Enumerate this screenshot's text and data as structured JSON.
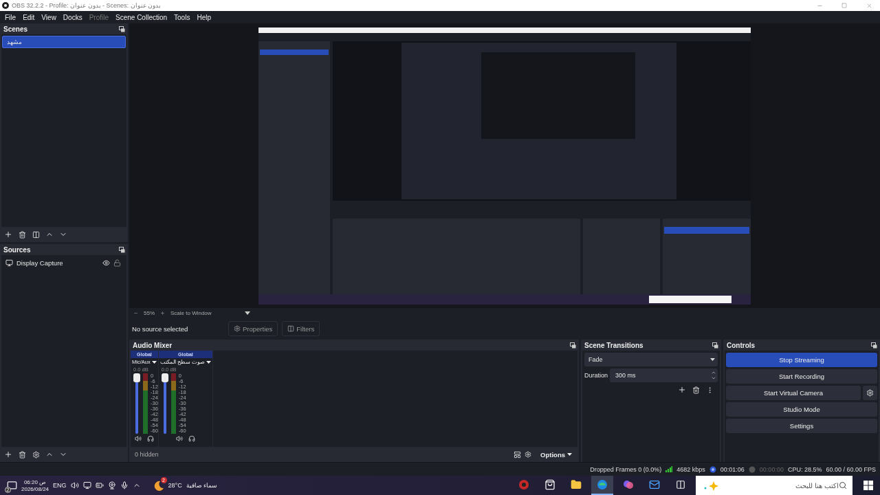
{
  "window": {
    "title": "OBS 32.2.2 - Profile: بدون عنوان - Scenes: بدون عنوان"
  },
  "menu": [
    {
      "label": "File",
      "disabled": false
    },
    {
      "label": "Edit",
      "disabled": false
    },
    {
      "label": "View",
      "disabled": false
    },
    {
      "label": "Docks",
      "disabled": false
    },
    {
      "label": "Profile",
      "disabled": true
    },
    {
      "label": "Scene Collection",
      "disabled": false
    },
    {
      "label": "Tools",
      "disabled": false
    },
    {
      "label": "Help",
      "disabled": false
    }
  ],
  "scenes": {
    "title": "Scenes",
    "items": [
      {
        "name": "مشهد",
        "selected": true
      }
    ]
  },
  "sources": {
    "title": "Sources",
    "items": [
      {
        "name": "Display Capture",
        "visible": true,
        "locked": false
      }
    ]
  },
  "zoom_bar": {
    "zoom": "55%",
    "scale_mode": "Scale to Window"
  },
  "source_bar": {
    "status": "No source selected",
    "buttons": [
      {
        "kind": "properties",
        "label": "Properties"
      },
      {
        "kind": "filters",
        "label": "Filters"
      }
    ]
  },
  "audio_mixer": {
    "title": "Audio Mixer",
    "channels": [
      {
        "tag": "Global",
        "name": "Mic/Aux",
        "reading": "0.0 dB",
        "level": 1,
        "muted": false,
        "scale": [
          "0",
          "-6",
          "-12",
          "-18",
          "-24",
          "-30",
          "-36",
          "-42",
          "-48",
          "-54",
          "-60"
        ]
      },
      {
        "tag": "Global",
        "name": "صوت سطح المكتب",
        "reading": "0.0 dB",
        "level": 1,
        "muted": false,
        "scale": [
          "0",
          "-6",
          "-12",
          "-18",
          "-24",
          "-30",
          "-36",
          "-42",
          "-48",
          "-54",
          "-60"
        ]
      }
    ],
    "hidden_count": "0 hidden",
    "options": "Options"
  },
  "scene_transitions": {
    "title": "Scene Transitions",
    "transition": "Fade",
    "duration_label": "Duration",
    "duration": "300 ms"
  },
  "controls": {
    "title": "Controls",
    "buttons": [
      {
        "label": "Stop Streaming",
        "active": true,
        "has_settings": false
      },
      {
        "label": "Start Recording",
        "active": false,
        "has_settings": false
      },
      {
        "label": "Start Virtual Camera",
        "active": false,
        "has_settings": true
      },
      {
        "label": "Studio Mode",
        "active": false,
        "has_settings": false
      },
      {
        "label": "Settings",
        "active": false,
        "has_settings": false
      }
    ]
  },
  "status_bar": {
    "dropped_frames": "Dropped Frames 0 (0.0%)",
    "bitrate": "4682 kbps",
    "stream_time": "00:01:06",
    "streaming": true,
    "record_time": "00:00:00",
    "recording": false,
    "cpu": "CPU: 28.5%",
    "fps": "60.00 / 60.00 FPS"
  },
  "taskbar": {
    "notifications": "2",
    "time": "06:20 ص",
    "date": "2026/08/24",
    "language": "ENG",
    "weather": {
      "alerts": "2",
      "temperature": "28°C",
      "condition": "سماء صافية"
    },
    "apps": [
      {
        "kind": "recorder",
        "selected": false
      },
      {
        "kind": "store",
        "selected": false
      },
      {
        "kind": "folder",
        "selected": false
      },
      {
        "kind": "browser",
        "selected": true
      },
      {
        "kind": "assistant",
        "selected": false
      },
      {
        "kind": "mail",
        "selected": false
      }
    ],
    "search": {
      "placeholder": "اكتب هنا للبحث"
    }
  }
}
